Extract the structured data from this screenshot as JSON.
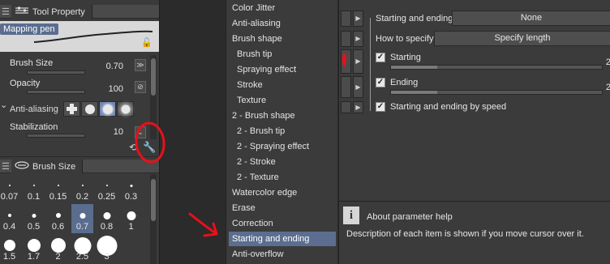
{
  "tool_property": {
    "tab_label": "Tool Property",
    "brush_name": "Mapping pen",
    "properties": [
      {
        "label": "Brush Size",
        "value": "0.70",
        "level": 0.7
      },
      {
        "label": "Opacity",
        "value": "100",
        "level": 1.0
      },
      {
        "label": "Stabilization",
        "value": "10",
        "level": 0.1
      }
    ],
    "anti_aliasing_label": "Anti-aliasing",
    "selected_anti_aliasing_index": 2
  },
  "brush_size_panel": {
    "tab_label": "Brush Size",
    "sizes": [
      "0.07",
      "0.1",
      "0.15",
      "0.2",
      "0.25",
      "0.3",
      "0.4",
      "0.5",
      "0.6",
      "0.7",
      "0.8",
      "1",
      "1.5",
      "1.7",
      "2",
      "2.5",
      "3"
    ],
    "selected": "0.7"
  },
  "categories": [
    {
      "label": "Color Jitter",
      "sub": false
    },
    {
      "label": "Anti-aliasing",
      "sub": false
    },
    {
      "label": "Brush shape",
      "sub": false
    },
    {
      "label": "Brush tip",
      "sub": true
    },
    {
      "label": "Spraying effect",
      "sub": true
    },
    {
      "label": "Stroke",
      "sub": true
    },
    {
      "label": "Texture",
      "sub": true
    },
    {
      "label": "2 - Brush shape",
      "sub": false
    },
    {
      "label": "2 - Brush tip",
      "sub": true
    },
    {
      "label": "2 - Spraying effect",
      "sub": true
    },
    {
      "label": "2 - Stroke",
      "sub": true
    },
    {
      "label": "2 - Texture",
      "sub": true
    },
    {
      "label": "Watercolor edge",
      "sub": false
    },
    {
      "label": "Erase",
      "sub": false
    },
    {
      "label": "Correction",
      "sub": false
    },
    {
      "label": "Starting and ending",
      "sub": false,
      "selected": true
    },
    {
      "label": "Anti-overflow",
      "sub": false
    }
  ],
  "settings": {
    "starting_and_ending_label": "Starting and ending",
    "starting_and_ending_value": "None",
    "how_to_specify_label": "How to specify",
    "how_to_specify_value": "Specify length",
    "starting_label": "Starting",
    "starting_checked": true,
    "starting_value": "2",
    "ending_label": "Ending",
    "ending_checked": true,
    "ending_value": "2",
    "by_speed_label": "Starting and ending by speed",
    "by_speed_checked": true
  },
  "help": {
    "icon_glyph": "i",
    "title": "About parameter help",
    "text": "Description of each item is shown if you move cursor over it."
  },
  "colors": {
    "selection": "#5c6e8f",
    "annotation": "#e8101a"
  }
}
